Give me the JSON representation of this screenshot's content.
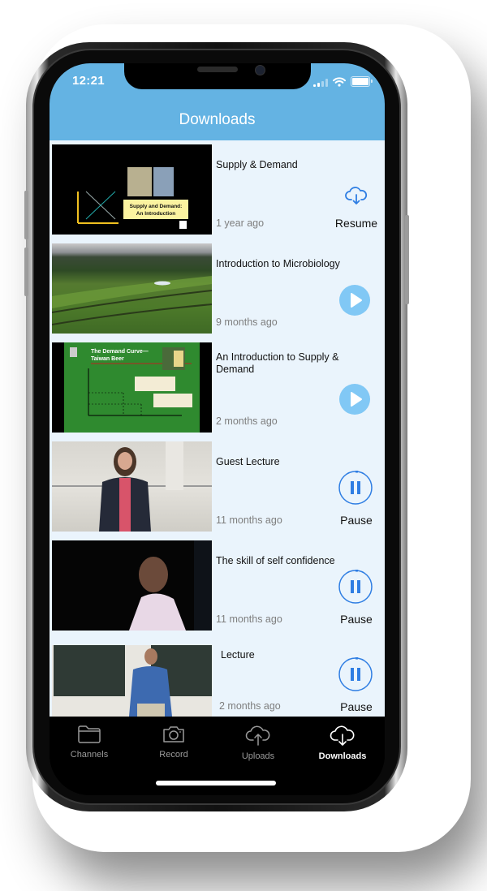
{
  "status_bar": {
    "time": "12:21"
  },
  "header": {
    "title": "Downloads"
  },
  "downloads": [
    {
      "title": "Supply & Demand",
      "age": "1 year ago",
      "action": "resume",
      "action_label": "Resume",
      "action_icon": "cloud-download-icon",
      "thumb": {
        "kind": "slide",
        "caption_line1": "Supply and Demand:",
        "caption_line2": "An Introduction"
      }
    },
    {
      "title": "Introduction to Microbiology",
      "age": "9 months ago",
      "action": "play",
      "action_label": "",
      "action_icon": "play-icon",
      "thumb": {
        "kind": "landscape"
      }
    },
    {
      "title": "An Introduction to Supply & Demand",
      "age": "2 months ago",
      "action": "play",
      "action_label": "",
      "action_icon": "play-icon",
      "thumb": {
        "kind": "chart-slide",
        "heading_line1": "The Demand Curve—",
        "heading_line2": "Taiwan Beer"
      }
    },
    {
      "title": "Guest Lecture",
      "age": "11 months ago",
      "action": "pause",
      "action_label": "Pause",
      "action_icon": "pause-icon",
      "progress": 0.02,
      "thumb": {
        "kind": "speaker-light"
      }
    },
    {
      "title": "The skill of self confidence",
      "age": "11 months ago",
      "action": "pause",
      "action_label": "Pause",
      "action_icon": "pause-icon",
      "progress": 0.02,
      "thumb": {
        "kind": "speaker-dark"
      }
    },
    {
      "title": "Lecture",
      "age": "2 months ago",
      "action": "pause",
      "action_label": "Pause",
      "action_icon": "pause-icon",
      "progress": 0.02,
      "thumb": {
        "kind": "chalkboard"
      }
    }
  ],
  "tabbar": {
    "tabs": [
      {
        "label": "Channels",
        "icon": "folder-icon",
        "active": false
      },
      {
        "label": "Record",
        "icon": "camera-icon",
        "active": false
      },
      {
        "label": "Uploads",
        "icon": "cloud-upload-icon",
        "active": false
      },
      {
        "label": "Downloads",
        "icon": "cloud-download-icon",
        "active": true
      }
    ]
  },
  "colors": {
    "header": "#64b3e3",
    "list_bg": "#eaf4fc",
    "accent": "#2f7ee3",
    "play": "#81c8f5",
    "tabbar": "#000000"
  }
}
